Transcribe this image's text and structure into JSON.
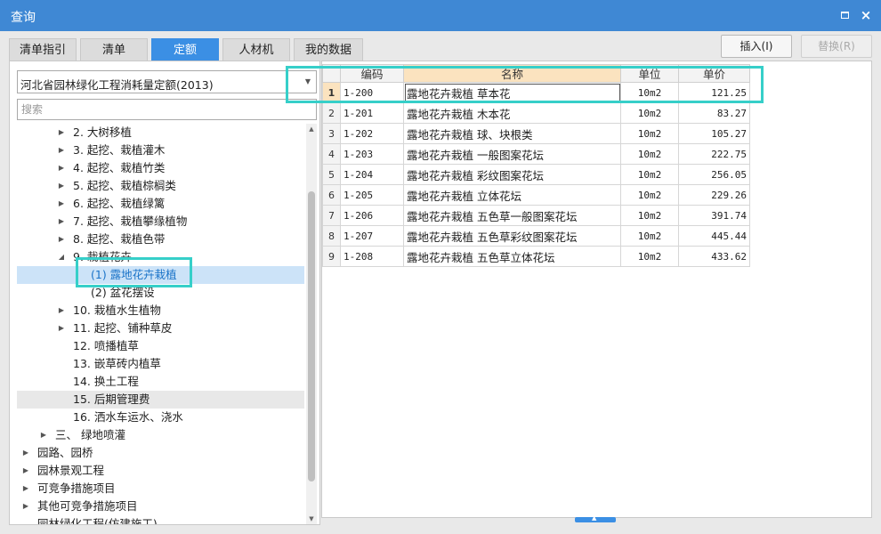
{
  "window": {
    "title": "查询",
    "maximize_label": "□",
    "close_label": "×"
  },
  "tabs": [
    {
      "label": "清单指引",
      "active": false
    },
    {
      "label": "清单",
      "active": false
    },
    {
      "label": "定额",
      "active": true
    },
    {
      "label": "人材机",
      "active": false
    },
    {
      "label": "我的数据",
      "active": false
    }
  ],
  "actions": {
    "insert_label": "插入(I)",
    "replace_label": "替换(R)"
  },
  "left": {
    "library_value": "河北省园林绿化工程消耗量定额(2013)",
    "search_placeholder": "搜索",
    "tree": [
      {
        "label": "2. 大树移植",
        "toggle": "▶"
      },
      {
        "label": "3. 起挖、栽植灌木",
        "toggle": "▶"
      },
      {
        "label": "4. 起挖、栽植竹类",
        "toggle": "▶"
      },
      {
        "label": "5. 起挖、栽植棕榈类",
        "toggle": "▶"
      },
      {
        "label": "6. 起挖、栽植绿篱",
        "toggle": "▶"
      },
      {
        "label": "7. 起挖、栽植攀缘植物",
        "toggle": "▶"
      },
      {
        "label": "8. 起挖、栽植色带",
        "toggle": "▶"
      },
      {
        "label": "9. 栽植花卉",
        "toggle": "◢"
      },
      {
        "label": "(1) 露地花卉栽植",
        "toggle": ""
      },
      {
        "label": "(2) 盆花摆设",
        "toggle": ""
      },
      {
        "label": "10. 栽植水生植物",
        "toggle": "▶"
      },
      {
        "label": "11. 起挖、铺种草皮",
        "toggle": "▶"
      },
      {
        "label": "12. 喷播植草",
        "toggle": ""
      },
      {
        "label": "13. 嵌草砖内植草",
        "toggle": ""
      },
      {
        "label": "14. 换土工程",
        "toggle": ""
      },
      {
        "label": "15. 后期管理费",
        "toggle": ""
      },
      {
        "label": "16. 洒水车运水、浇水",
        "toggle": ""
      },
      {
        "label": "三、 绿地喷灌",
        "toggle": "▶"
      },
      {
        "label": "园路、园桥",
        "toggle": "▶"
      },
      {
        "label": "园林景观工程",
        "toggle": "▶"
      },
      {
        "label": "可竞争措施项目",
        "toggle": "▶"
      },
      {
        "label": "其他可竞争措施项目",
        "toggle": "▶"
      },
      {
        "label": "园林绿化工程(仿建施工)",
        "toggle": ""
      }
    ]
  },
  "grid": {
    "headers": {
      "code": "编码",
      "name": "名称",
      "unit": "单位",
      "price": "单价"
    },
    "rows": [
      {
        "no": "1",
        "code": "1-200",
        "name": "露地花卉栽植 草本花",
        "unit": "10m2",
        "price": "121.25"
      },
      {
        "no": "2",
        "code": "1-201",
        "name": "露地花卉栽植 木本花",
        "unit": "10m2",
        "price": "83.27"
      },
      {
        "no": "3",
        "code": "1-202",
        "name": "露地花卉栽植 球、块根类",
        "unit": "10m2",
        "price": "105.27"
      },
      {
        "no": "4",
        "code": "1-203",
        "name": "露地花卉栽植 一般图案花坛",
        "unit": "10m2",
        "price": "222.75"
      },
      {
        "no": "5",
        "code": "1-204",
        "name": "露地花卉栽植 彩纹图案花坛",
        "unit": "10m2",
        "price": "256.05"
      },
      {
        "no": "6",
        "code": "1-205",
        "name": "露地花卉栽植 立体花坛",
        "unit": "10m2",
        "price": "229.26"
      },
      {
        "no": "7",
        "code": "1-206",
        "name": "露地花卉栽植 五色草一般图案花坛",
        "unit": "10m2",
        "price": "391.74"
      },
      {
        "no": "8",
        "code": "1-207",
        "name": "露地花卉栽植 五色草彩纹图案花坛",
        "unit": "10m2",
        "price": "445.44"
      },
      {
        "no": "9",
        "code": "1-208",
        "name": "露地花卉栽植 五色草立体花坛",
        "unit": "10m2",
        "price": "433.62"
      }
    ]
  },
  "colors": {
    "titlebar": "#3f88d4",
    "active_tab": "#3b8fe4",
    "highlight": "#36cfc9",
    "selected_row": "#cce3f8"
  }
}
